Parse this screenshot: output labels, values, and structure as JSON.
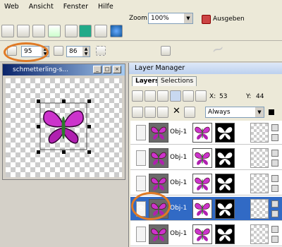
{
  "menu": [
    "Web",
    "Ansicht",
    "Fenster",
    "Hilfe"
  ],
  "toolbar": {
    "zoom_label": "Zoom",
    "zoom_value": "100%",
    "ausgeben_label": "Ausgeben"
  },
  "props": {
    "opacity": "95",
    "second": "86"
  },
  "document": {
    "title": "schmetterling-s..."
  },
  "layer_manager": {
    "title": "Layer Manager",
    "tabs": [
      "Layers",
      "Selections"
    ],
    "x_label": "X:",
    "x_value": "53",
    "y_label": "Y:",
    "y_value": "44",
    "blend_mode": "Always",
    "layers": [
      {
        "name": "Obj-1",
        "selected": false,
        "visible": false
      },
      {
        "name": "Obj-1",
        "selected": false,
        "visible": false
      },
      {
        "name": "Obj-1",
        "selected": false,
        "visible": false
      },
      {
        "name": "Obj-1",
        "selected": true,
        "visible": true
      },
      {
        "name": "Obj-1",
        "selected": false,
        "visible": false
      }
    ]
  },
  "colors": {
    "accent_orange": "#e07a25",
    "butterfly_purple": "#cc33cc",
    "selection_blue": "#316ac5"
  }
}
